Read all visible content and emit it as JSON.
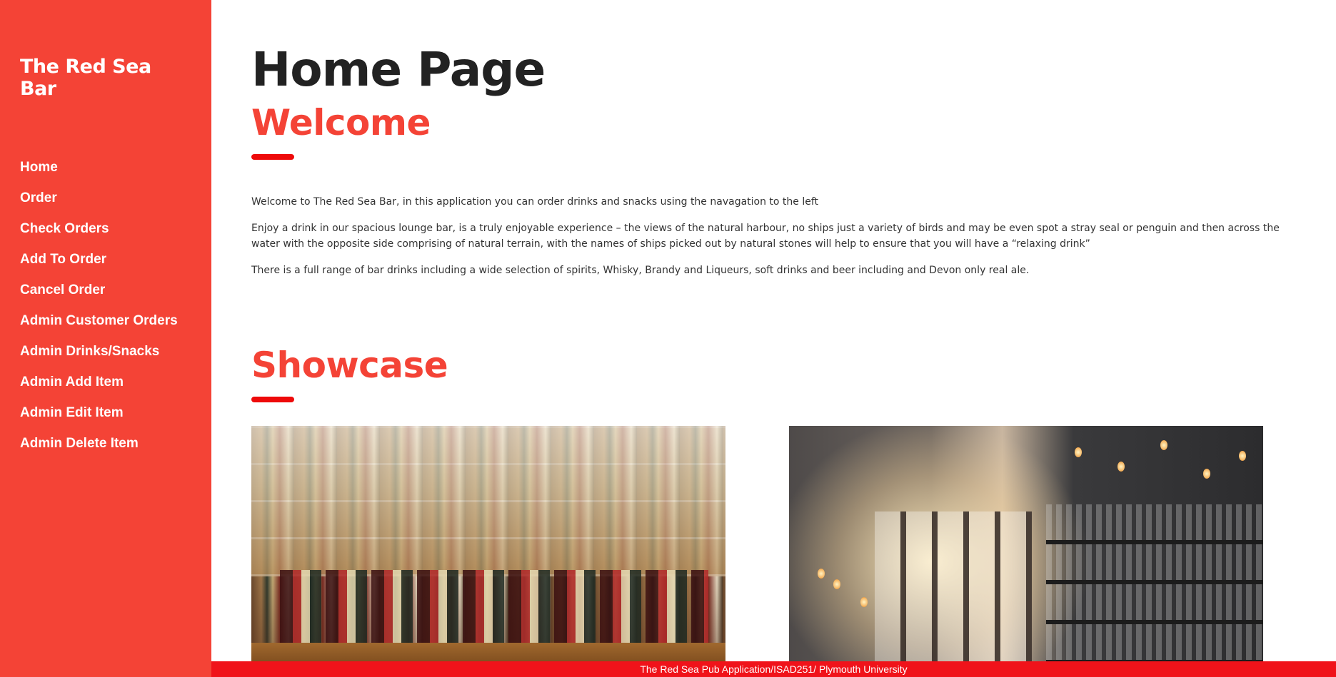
{
  "sidebar": {
    "brand": "The Red Sea Bar",
    "nav": [
      {
        "label": "Home"
      },
      {
        "label": "Order"
      },
      {
        "label": "Check Orders"
      },
      {
        "label": "Add To Order"
      },
      {
        "label": "Cancel Order"
      },
      {
        "label": "Admin Customer Orders"
      },
      {
        "label": "Admin Drinks/Snacks"
      },
      {
        "label": "Admin Add Item"
      },
      {
        "label": "Admin Edit Item"
      },
      {
        "label": "Admin Delete Item"
      }
    ]
  },
  "main": {
    "title": "Home Page",
    "welcome": {
      "heading": "Welcome",
      "paragraphs": [
        "Welcome to The Red Sea Bar, in this application you can order drinks and snacks using the navagation to the left",
        "Enjoy a drink in our spacious lounge bar, is a truly enjoyable experience – the views of the natural harbour, no ships just a variety of birds and may be even spot a stray seal or penguin and then across the water with the opposite side comprising of natural terrain, with the names of ships picked out by natural stones will help to ensure that you will have a “relaxing drink”",
        "There is a full range of bar drinks including a wide selection of spirits, Whisky, Brandy and Liqueurs, soft drinks and beer including and Devon only real ale."
      ]
    },
    "showcase": {
      "heading": "Showcase"
    }
  },
  "footer": {
    "text": "The Red Sea Pub Application/ISAD251/ Plymouth University"
  },
  "colors": {
    "sidebar_bg": "#f44336",
    "accent": "#f44336",
    "underline": "#ee0a0a",
    "footer_bg": "#f0131a"
  }
}
